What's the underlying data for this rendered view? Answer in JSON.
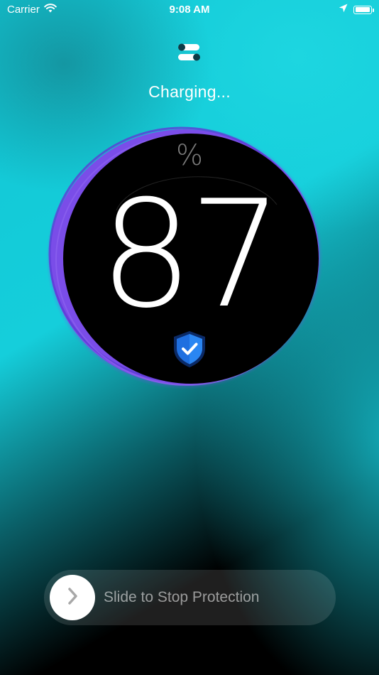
{
  "status_bar": {
    "carrier": "Carrier",
    "time": "9:08 AM",
    "icons": [
      "wifi-icon",
      "location-arrow-icon",
      "battery-icon"
    ],
    "battery_level": 1.0
  },
  "header": {
    "settings_icon": "settings-toggle-icon",
    "status_text": "Charging..."
  },
  "gauge": {
    "unit": "%",
    "value": "87",
    "level_fraction": 0.87,
    "badge_icon": "shield-check-icon",
    "colors": {
      "ring": "#7b4be6",
      "ring_edge": "#5a3fd0",
      "face": "#000000",
      "shield": "#1f6fe0"
    }
  },
  "slider": {
    "label": "Slide to Stop Protection",
    "knob_icon": "chevron-right-icon"
  },
  "colors": {
    "background_cyan": "#15cedb",
    "background_dark": "#000000"
  }
}
